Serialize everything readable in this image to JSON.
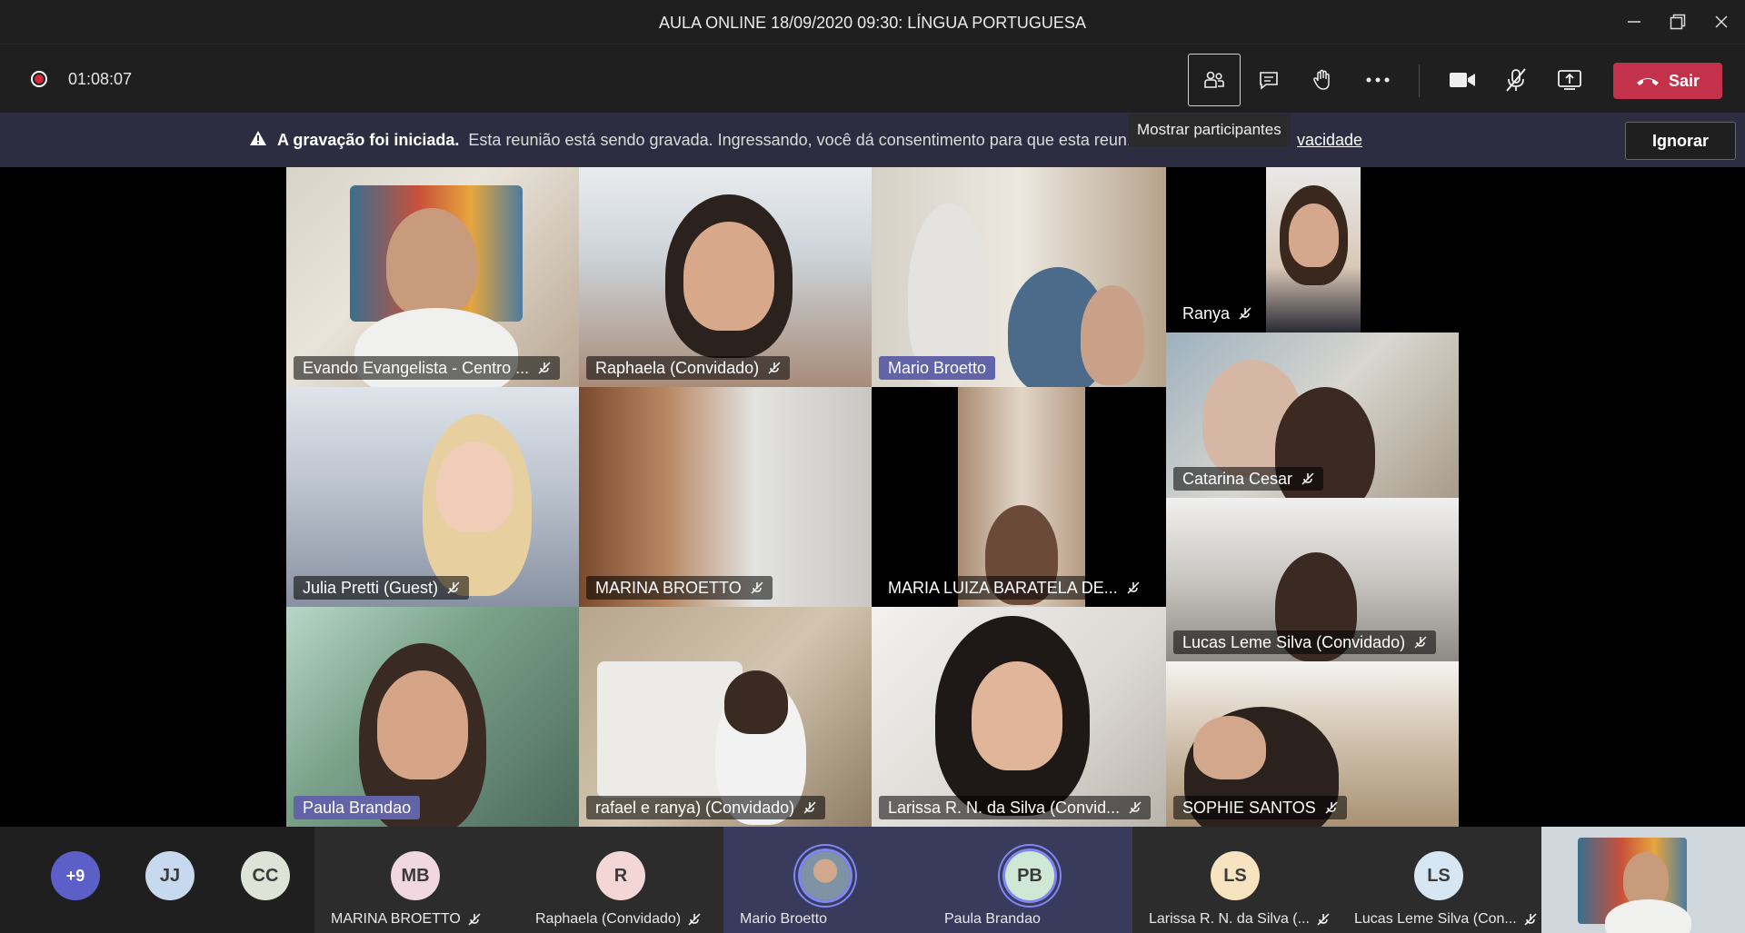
{
  "window": {
    "title": "AULA ONLINE 18/09/2020 09:30: LÍNGUA PORTUGUESA"
  },
  "toolbar": {
    "timer": "01:08:07",
    "leave_label": "Sair",
    "tooltip": "Mostrar participantes"
  },
  "banner": {
    "title": "A gravação foi iniciada.",
    "message": "Esta reunião está sendo gravada. Ingressando, você dá consentimento para que esta reunião se",
    "privacy_link": "vacidade",
    "ignore_label": "Ignorar"
  },
  "tiles": [
    {
      "name": "Evando Evangelista - Centro ...",
      "speaking": false
    },
    {
      "name": "Raphaela (Convidado)",
      "speaking": false
    },
    {
      "name": "Mario Broetto",
      "speaking": true
    },
    {
      "name": "Ranya",
      "speaking": false
    },
    {
      "name": "Julia Pretti (Guest)",
      "speaking": false
    },
    {
      "name": "MARINA BROETTO",
      "speaking": false
    },
    {
      "name": "MARIA LUIZA BARATELA DE...",
      "speaking": false
    },
    {
      "name": "Catarina Cesar",
      "speaking": false
    },
    {
      "name": "Lucas Leme Silva (Convidado)",
      "speaking": false
    },
    {
      "name": "Paula Brandao",
      "speaking": true
    },
    {
      "name": "rafael e ranya) (Convidado)",
      "speaking": false
    },
    {
      "name": "Larissa R. N. da Silva (Convid...",
      "speaking": false
    },
    {
      "name": "SOPHIE SANTOS",
      "speaking": false
    }
  ],
  "strip": {
    "overflow": "+9",
    "avatars": [
      {
        "initials": "JJ",
        "color": "#c7d9ee"
      },
      {
        "initials": "CC",
        "color": "#dde3d6"
      }
    ],
    "participants": [
      {
        "initials": "MB",
        "name": "MARINA BROETTO",
        "color": "#f0d7e0"
      },
      {
        "initials": "R",
        "name": "Raphaela (Convidado)",
        "color": "#f5d6d6"
      },
      {
        "initials": "",
        "name": "Mario Broetto",
        "color": "#8ea5b3"
      },
      {
        "initials": "PB",
        "name": "Paula Brandao",
        "color": "#cfe8d6"
      },
      {
        "initials": "LS",
        "name": "Larissa R. N. da Silva (...",
        "color": "#f7e3bf"
      },
      {
        "initials": "LS",
        "name": "Lucas Leme Silva (Con...",
        "color": "#d6e6f2"
      }
    ]
  },
  "colors": {
    "accent": "#6264a7",
    "leave": "#c4314b",
    "banner": "#2d2c40"
  }
}
